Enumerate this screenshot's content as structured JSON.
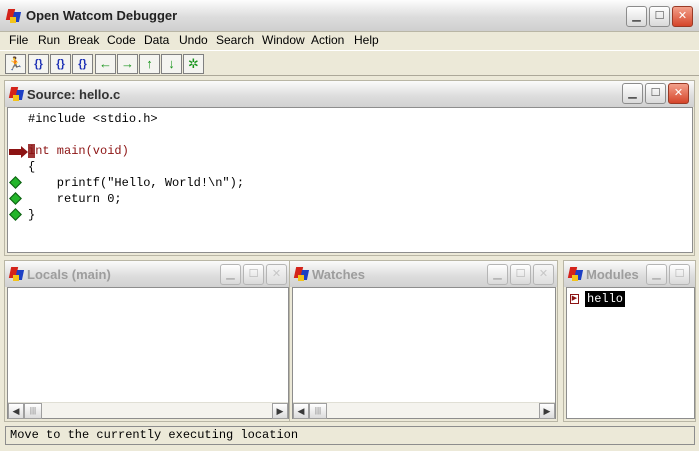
{
  "window": {
    "title": "Open Watcom Debugger",
    "logo": "watcom-logo-icon"
  },
  "menu": [
    "File",
    "Run",
    "Break",
    "Code",
    "Data",
    "Undo",
    "Search",
    "Window",
    "Action",
    "Help"
  ],
  "toolbar": [
    {
      "name": "go-button",
      "glyph": "🏃"
    },
    {
      "name": "trace-over-button",
      "glyph": "{}"
    },
    {
      "name": "trace-into-button",
      "glyph": "{}"
    },
    {
      "name": "return-to-caller-button",
      "glyph": "{}"
    },
    {
      "name": "undo-button",
      "glyph": "←"
    },
    {
      "name": "redo-button",
      "glyph": "→"
    },
    {
      "name": "up-stack-button",
      "glyph": "↑"
    },
    {
      "name": "down-stack-button",
      "glyph": "↓"
    },
    {
      "name": "home-button",
      "glyph": "✲"
    }
  ],
  "source": {
    "title": "Source: hello.c",
    "lines": [
      {
        "text": "#include <stdio.h>",
        "marker": "none"
      },
      {
        "text": "",
        "marker": "none"
      },
      {
        "text": "int main(void)",
        "marker": "current"
      },
      {
        "text": "{",
        "marker": "none"
      },
      {
        "text": "    printf(\"Hello, World!\\n\");",
        "marker": "breakable"
      },
      {
        "text": "    return 0;",
        "marker": "breakable"
      },
      {
        "text": "}",
        "marker": "breakable"
      }
    ]
  },
  "locals": {
    "title": "Locals (main)"
  },
  "watches": {
    "title": "Watches"
  },
  "modules": {
    "title": "Modules",
    "items": [
      "hello"
    ]
  },
  "status": {
    "text": "Move to the currently executing location"
  }
}
